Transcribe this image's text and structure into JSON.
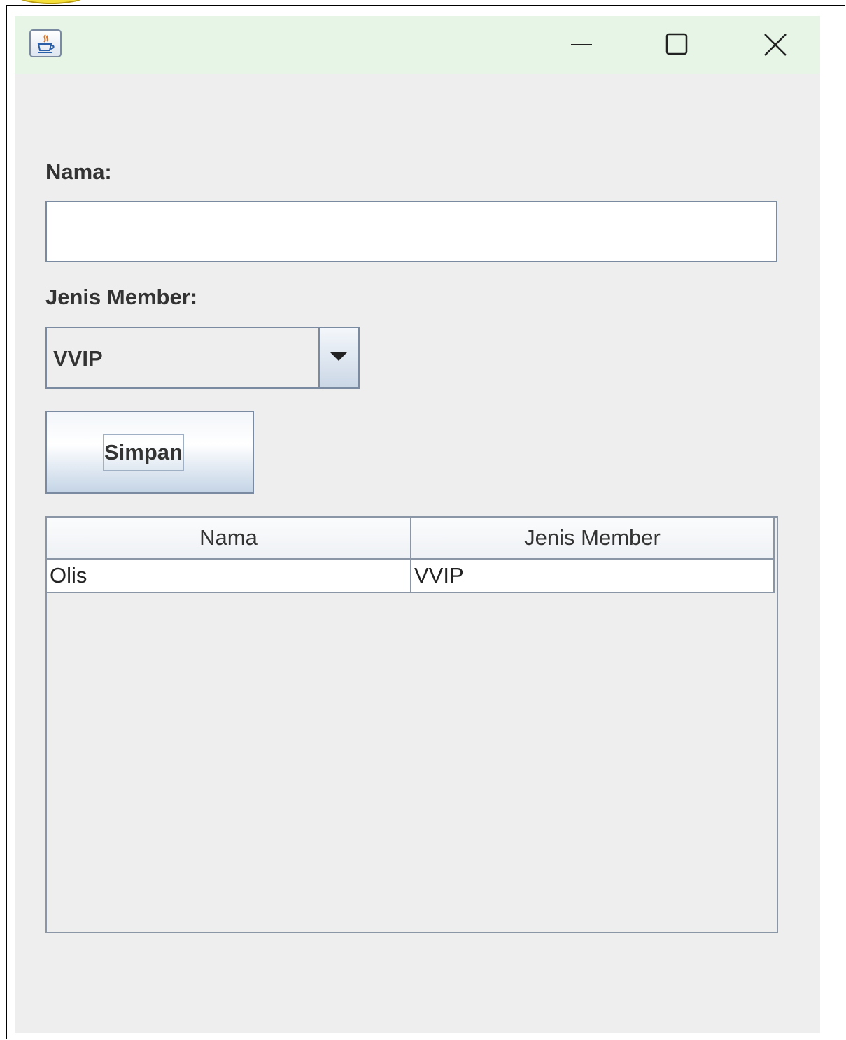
{
  "window": {
    "minimize_glyph": "—",
    "maximize_glyph": "☐",
    "close_glyph": "✕"
  },
  "form": {
    "name_label": "Nama:",
    "name_value": "",
    "member_label": "Jenis Member:",
    "member_selected": "VVIP",
    "save_label": "Simpan"
  },
  "table": {
    "columns": [
      "Nama",
      "Jenis Member"
    ],
    "rows": [
      [
        "Olis",
        "VVIP"
      ]
    ]
  },
  "icons": {
    "app": "java-coffee-cup-icon",
    "combo_arrow": "triangle-down-icon"
  }
}
